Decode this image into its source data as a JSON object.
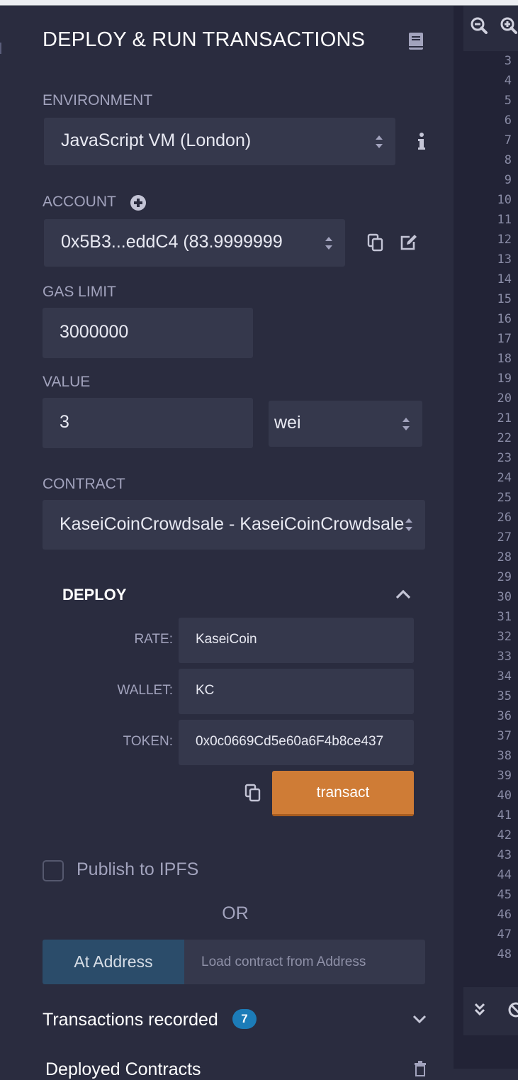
{
  "panel": {
    "title": "DEPLOY & RUN TRANSACTIONS",
    "environment": {
      "label": "ENVIRONMENT",
      "value": "JavaScript VM (London)"
    },
    "account": {
      "label": "ACCOUNT",
      "value": "0x5B3...eddC4 (83.9999999"
    },
    "gas_limit": {
      "label": "GAS LIMIT",
      "value": "3000000"
    },
    "value": {
      "label": "VALUE",
      "amount": "3",
      "unit": "wei"
    },
    "contract": {
      "label": "CONTRACT",
      "value": "KaseiCoinCrowdsale - KaseiCoinCrowdsale"
    },
    "deploy": {
      "label": "DEPLOY",
      "params": [
        {
          "name": "RATE:",
          "value": "KaseiCoin"
        },
        {
          "name": "WALLET:",
          "value": "KC"
        },
        {
          "name": "TOKEN:",
          "value": "0x0c0669Cd5e60a6F4b8ce437"
        }
      ],
      "transact_label": "transact"
    },
    "publish_label": "Publish to IPFS",
    "or_label": "OR",
    "at_address": {
      "button": "At Address",
      "placeholder": "Load contract from Address"
    },
    "transactions": {
      "label": "Transactions recorded",
      "count": "7"
    },
    "deployed_label": "Deployed Contracts"
  },
  "editor": {
    "line_numbers": [
      "3",
      "4",
      "5",
      "6",
      "7",
      "8",
      "9",
      "10",
      "11",
      "12",
      "13",
      "14",
      "15",
      "16",
      "17",
      "18",
      "19",
      "20",
      "21",
      "22",
      "23",
      "24",
      "25",
      "26",
      "27",
      "28",
      "29",
      "30",
      "31",
      "32",
      "33",
      "34",
      "35",
      "36",
      "37",
      "38",
      "39",
      "40",
      "41",
      "42",
      "43",
      "44",
      "45",
      "46",
      "47",
      "48"
    ]
  },
  "colors": {
    "accent": "#cf7c36",
    "badge": "#1c7cb8",
    "panel_bg": "#2a2c3f",
    "input_bg": "#35384c"
  }
}
